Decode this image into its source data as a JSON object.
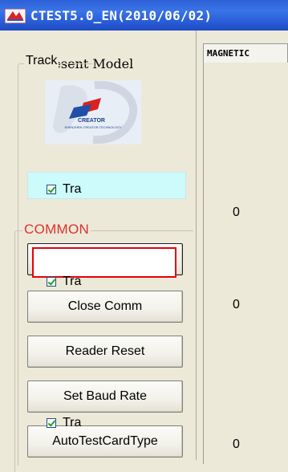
{
  "window": {
    "title": "CTEST5.0_EN(2010/06/02)"
  },
  "left": {
    "present_model_label": "Present Model",
    "logo_text": "CREATOR",
    "logo_subtext": "SHENZHEN CREATOR TECHNOLOGY",
    "common_group_label": "COMMON",
    "buttons": {
      "focused": "",
      "close_comm": "Close Comm",
      "reader_reset": "Reader Reset",
      "set_baud_rate": "Set Baud Rate",
      "auto_test_card_type": "AutoTestCardType"
    }
  },
  "right": {
    "tab_label": "MAGNETIC",
    "track_group_label": "Track",
    "tracks": [
      {
        "label": "Tra",
        "value": "0"
      },
      {
        "label": "Tra",
        "value": "0"
      },
      {
        "label": "Tra",
        "value": "0"
      }
    ]
  },
  "colors": {
    "titlebar": "#2a5ed8",
    "status_box": "#cdfafa",
    "focus_ring": "#e8000b",
    "common_label": "#e03030"
  }
}
